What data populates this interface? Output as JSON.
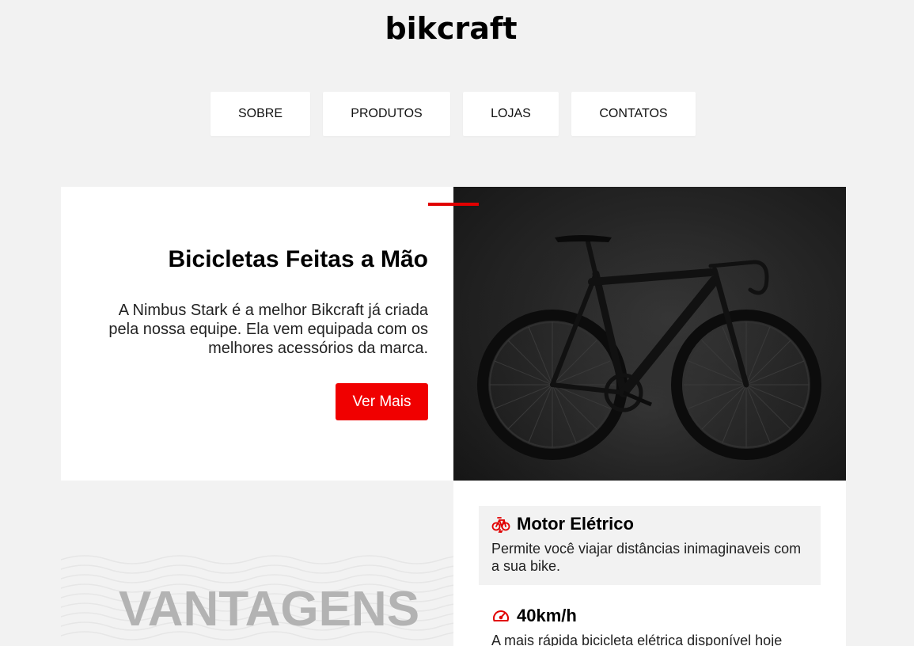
{
  "header": {
    "logo": "bikcraft"
  },
  "nav": {
    "items": [
      {
        "label": "SOBRE"
      },
      {
        "label": "PRODUTOS"
      },
      {
        "label": "LOJAS"
      },
      {
        "label": "CONTATOS"
      }
    ]
  },
  "hero": {
    "title": "Bicicletas Feitas a Mão",
    "text": "A Nimbus Stark é a melhor Bikcraft já criada pela nossa equipe. Ela vem equipada com os melhores acessórios da marca.",
    "button_label": "Ver Mais",
    "accent_color": "#f00000",
    "image_icon": "bicycle-photo"
  },
  "vantagens": {
    "title": "VANTAGENS",
    "features": [
      {
        "icon": "electric-bike-icon",
        "title": "Motor Elétrico",
        "text": "Permite você viajar distâncias inimaginaveis com a sua bike."
      },
      {
        "icon": "speedometer-icon",
        "title": "40km/h",
        "text": "A mais rápida bicicleta elétrica disponível hoje"
      }
    ]
  }
}
